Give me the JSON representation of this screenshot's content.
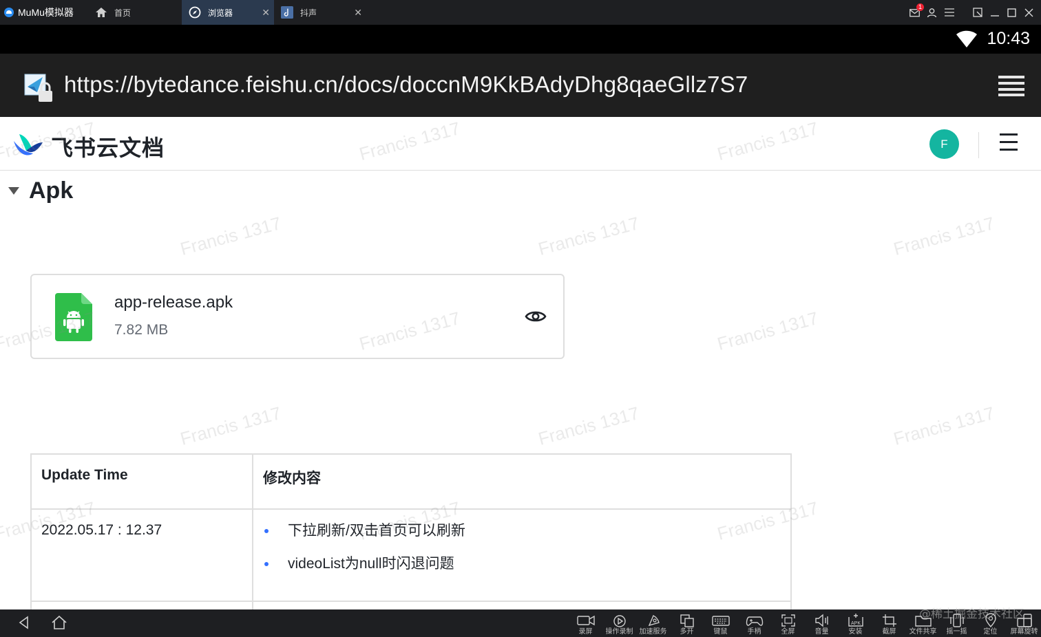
{
  "titlebar": {
    "app_name": "MuMu模拟器",
    "tabs": [
      {
        "label": "首页",
        "icon": "home-icon"
      },
      {
        "label": "浏览器",
        "icon": "browser-icon",
        "active": true
      },
      {
        "label": "抖声",
        "icon": "app-icon"
      }
    ],
    "notification_count": "1"
  },
  "statusbar": {
    "time": "10:43"
  },
  "urlbar": {
    "url": "https://bytedance.feishu.cn/docs/doccnM9KkBAdyDhg8qaeGllz7S7"
  },
  "doc": {
    "brand": "飞书云文档",
    "avatar_letter": "F",
    "section_title": "Apk",
    "file": {
      "name": "app-release.apk",
      "size": "7.82 MB"
    },
    "table": {
      "headers": [
        "Update Time",
        "修改内容"
      ],
      "rows": [
        {
          "time": "2022.05.17 : 12.37",
          "changes": [
            "下拉刷新/双击首页可以刷新",
            "videoList为null时闪退问题"
          ]
        }
      ]
    },
    "watermark_text": "Francis 1317"
  },
  "bottombar": {
    "tools": [
      "录屏",
      "操作录制",
      "加速服务",
      "多开",
      "键鼠",
      "手柄",
      "全屏",
      "音量",
      "安装",
      "截屏",
      "文件共享",
      "摇一摇",
      "定位",
      "屏幕旋转"
    ]
  },
  "corner_watermark": "@稀土掘金技术社区",
  "colors": {
    "accent": "#3370ff",
    "avatar": "#14b5a0",
    "apk_green": "#2fbe4a"
  }
}
